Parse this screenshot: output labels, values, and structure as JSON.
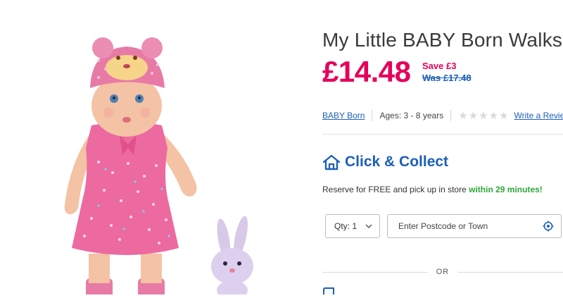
{
  "product": {
    "title": "My Little BABY Born Walks",
    "price": "£14.48",
    "save": "Save £3",
    "was": "Was £17.48",
    "brand": "BABY Born",
    "ages": "Ages: 3 - 8 years",
    "rating_stars": 5,
    "review_link": "Write a Review",
    "image_icon": "doll-with-bunny-image"
  },
  "click_collect": {
    "icon": "home-icon",
    "title": "Click & Collect",
    "reserve_text": "Reserve for FREE and pick up in store",
    "reserve_highlight": "within 29 minutes!",
    "qty_label": "Qty: 1",
    "postcode_placeholder": "Enter Postcode or Town",
    "locate_icon": "locate-icon"
  },
  "divider": {
    "text": "OR"
  },
  "colors": {
    "price": "#e5005a",
    "link": "#1c5fb8",
    "highlight": "#2fa53a"
  }
}
